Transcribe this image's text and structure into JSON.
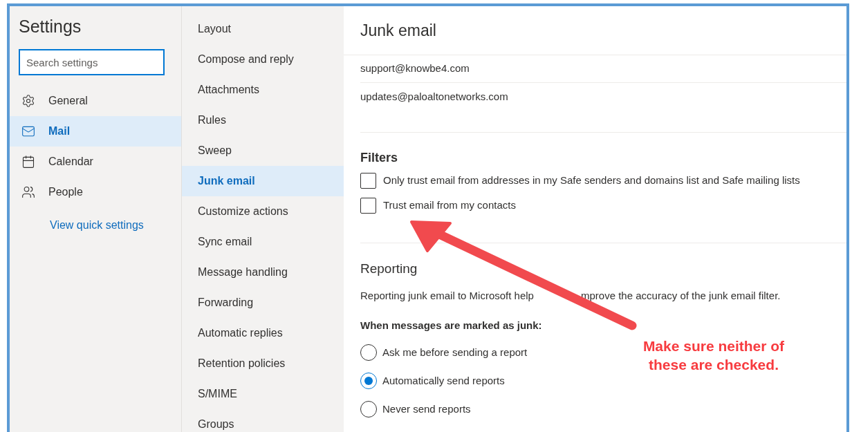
{
  "settings": {
    "title": "Settings",
    "search": {
      "placeholder": "Search settings"
    },
    "categories": [
      {
        "label": "General",
        "selected": false
      },
      {
        "label": "Mail",
        "selected": true
      },
      {
        "label": "Calendar",
        "selected": false
      },
      {
        "label": "People",
        "selected": false
      }
    ],
    "link": "View quick settings"
  },
  "mail_sections": [
    {
      "label": "Layout",
      "selected": false
    },
    {
      "label": "Compose and reply",
      "selected": false
    },
    {
      "label": "Attachments",
      "selected": false
    },
    {
      "label": "Rules",
      "selected": false
    },
    {
      "label": "Sweep",
      "selected": false
    },
    {
      "label": "Junk email",
      "selected": true
    },
    {
      "label": "Customize actions",
      "selected": false
    },
    {
      "label": "Sync email",
      "selected": false
    },
    {
      "label": "Message handling",
      "selected": false
    },
    {
      "label": "Forwarding",
      "selected": false
    },
    {
      "label": "Automatic replies",
      "selected": false
    },
    {
      "label": "Retention policies",
      "selected": false
    },
    {
      "label": "S/MIME",
      "selected": false
    },
    {
      "label": "Groups",
      "selected": false
    }
  ],
  "panel": {
    "title": "Junk email",
    "senders": [
      "support@knowbe4.com",
      "updates@paloaltonetworks.com"
    ],
    "filters": {
      "title": "Filters",
      "options": [
        {
          "label": "Only trust email from addresses in my Safe senders and domains list and Safe mailing lists",
          "checked": false
        },
        {
          "label": "Trust email from my contacts",
          "checked": false
        }
      ]
    },
    "reporting": {
      "title": "Reporting",
      "description": [
        "Reporting junk email to Microsoft help",
        "mprove the accuracy of the junk email filter."
      ],
      "question": "When messages are marked as junk:",
      "options": [
        {
          "label": "Ask me before sending a report",
          "selected": false
        },
        {
          "label": "Automatically send reports",
          "selected": true
        },
        {
          "label": "Never send reports",
          "selected": false
        }
      ]
    }
  },
  "annotation": {
    "lines": [
      "Make sure neither of",
      "these are checked."
    ]
  }
}
